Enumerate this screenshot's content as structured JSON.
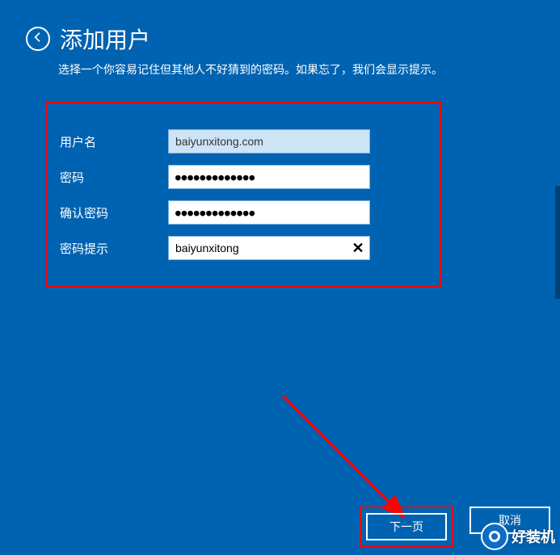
{
  "header": {
    "title": "添加用户",
    "subtitle": "选择一个你容易记住但其他人不好猜到的密码。如果忘了，我们会显示提示。"
  },
  "form": {
    "username": {
      "label": "用户名",
      "value": "baiyunxitong.com"
    },
    "password": {
      "label": "密码",
      "value": "●●●●●●●●●●●●●"
    },
    "confirm": {
      "label": "确认密码",
      "value": "●●●●●●●●●●●●●"
    },
    "hint": {
      "label": "密码提示",
      "value": "baiyunxitong"
    }
  },
  "buttons": {
    "next": "下一页",
    "cancel": "取消"
  },
  "watermark": {
    "text": "好装机"
  }
}
